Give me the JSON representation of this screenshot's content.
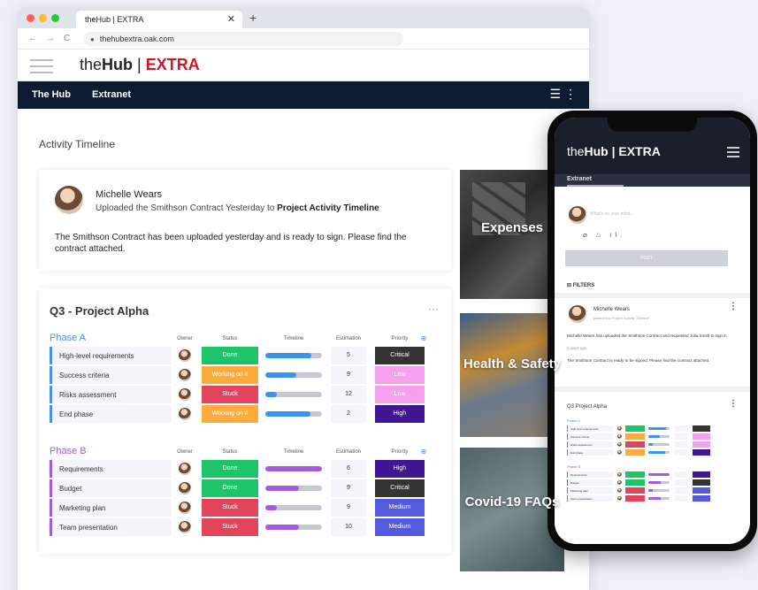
{
  "browser": {
    "tab_title": "theHub | EXTRA",
    "tab_close": "✕",
    "new_tab": "+",
    "url": "thehubextra.oak.com",
    "nav": [
      "←",
      "→",
      "C"
    ]
  },
  "app": {
    "logo_the": "the",
    "logo_hub": "Hub",
    "logo_sep": " | ",
    "logo_extra": "EXTRA",
    "nav_items": [
      "The Hub",
      "Extranet"
    ],
    "nav_icons": "☰ ⋮"
  },
  "activity": {
    "title": "Activity Timeline",
    "post": {
      "author": "Michelle Wears",
      "action_prefix": "Uploaded the Smithson Contract Yesterday to ",
      "action_target": "Project Activity Timeline",
      "body": "The Smithson Contract has been uploaded yesterday and is ready to sign. Please find the contract attached."
    }
  },
  "board": {
    "title": "Q3 - Project Alpha",
    "more": "···",
    "columns": [
      "Owner",
      "Status",
      "Timeline",
      "Estimation",
      "Priority"
    ],
    "settings_icon": "⊕",
    "phases": [
      {
        "name": "Phase A",
        "color": "#4e8df5",
        "rows": [
          {
            "name": "High-level requirements",
            "status": "Done",
            "status_color": "#1dc468",
            "timeline": 0.82,
            "timeline_color": "#3b93f0",
            "estimate": "5",
            "priority": "Critical",
            "priority_color": "#333333"
          },
          {
            "name": "Success criteria",
            "status": "Working on it",
            "status_color": "#fdab3d",
            "timeline": 0.55,
            "timeline_color": "#3b93f0",
            "estimate": "9",
            "priority": "Low",
            "priority_color": "#f7a0f0"
          },
          {
            "name": "Risks assessment",
            "status": "Stuck",
            "status_color": "#e2445c",
            "timeline": 0.2,
            "timeline_color": "#3b93f0",
            "estimate": "12",
            "priority": "Low",
            "priority_color": "#f7a0f0"
          },
          {
            "name": "End phase",
            "status": "Working on it",
            "status_color": "#fdab3d",
            "timeline": 0.8,
            "timeline_color": "#3b93f0",
            "estimate": "2",
            "priority": "High",
            "priority_color": "#401694"
          }
        ]
      },
      {
        "name": "Phase B",
        "color": "#a25ddc",
        "rows": [
          {
            "name": "Requirements",
            "status": "Done",
            "status_color": "#1dc468",
            "timeline": 1.0,
            "timeline_color": "#a25ddc",
            "estimate": "6",
            "priority": "High",
            "priority_color": "#401694"
          },
          {
            "name": "Budget",
            "status": "Done",
            "status_color": "#1dc468",
            "timeline": 0.6,
            "timeline_color": "#a25ddc",
            "estimate": "9",
            "priority": "Critical",
            "priority_color": "#333333"
          },
          {
            "name": "Marketing plan",
            "status": "Stuck",
            "status_color": "#e2445c",
            "timeline": 0.2,
            "timeline_color": "#a25ddc",
            "estimate": "9",
            "priority": "Medium",
            "priority_color": "#5559df"
          },
          {
            "name": "Team presentation",
            "status": "Stuck",
            "status_color": "#e2445c",
            "timeline": 0.6,
            "timeline_color": "#a25ddc",
            "estimate": "10",
            "priority": "Medium",
            "priority_color": "#5559df"
          }
        ]
      }
    ]
  },
  "tiles": [
    "Expenses",
    "Health & Safety",
    "Covid-19 FAQs"
  ],
  "phone": {
    "logo_the": "the",
    "logo_hub": "Hub",
    "logo_rest": " | EXTRA",
    "tab": "Extranet",
    "compose_placeholder": "What's on your mind...",
    "tools": "⌀ ⌂ ıl.",
    "post_button": "POST",
    "filters": "FILTERS",
    "post_author": "Michelle Wears",
    "post_meta": "posted to ▸ Project Activity Timeline",
    "post_text_1": "Michelle Wears has uploaded the Smithson Contract and requested Julia Smith to sign it.",
    "post_date": "2 days ago",
    "post_text_2": "The Smithson Contract is ready to be signed. Please find the contract attached.",
    "board_title": "Q3 Project Alpha",
    "phase_a": "Phase A",
    "phase_b": "Phase B"
  }
}
